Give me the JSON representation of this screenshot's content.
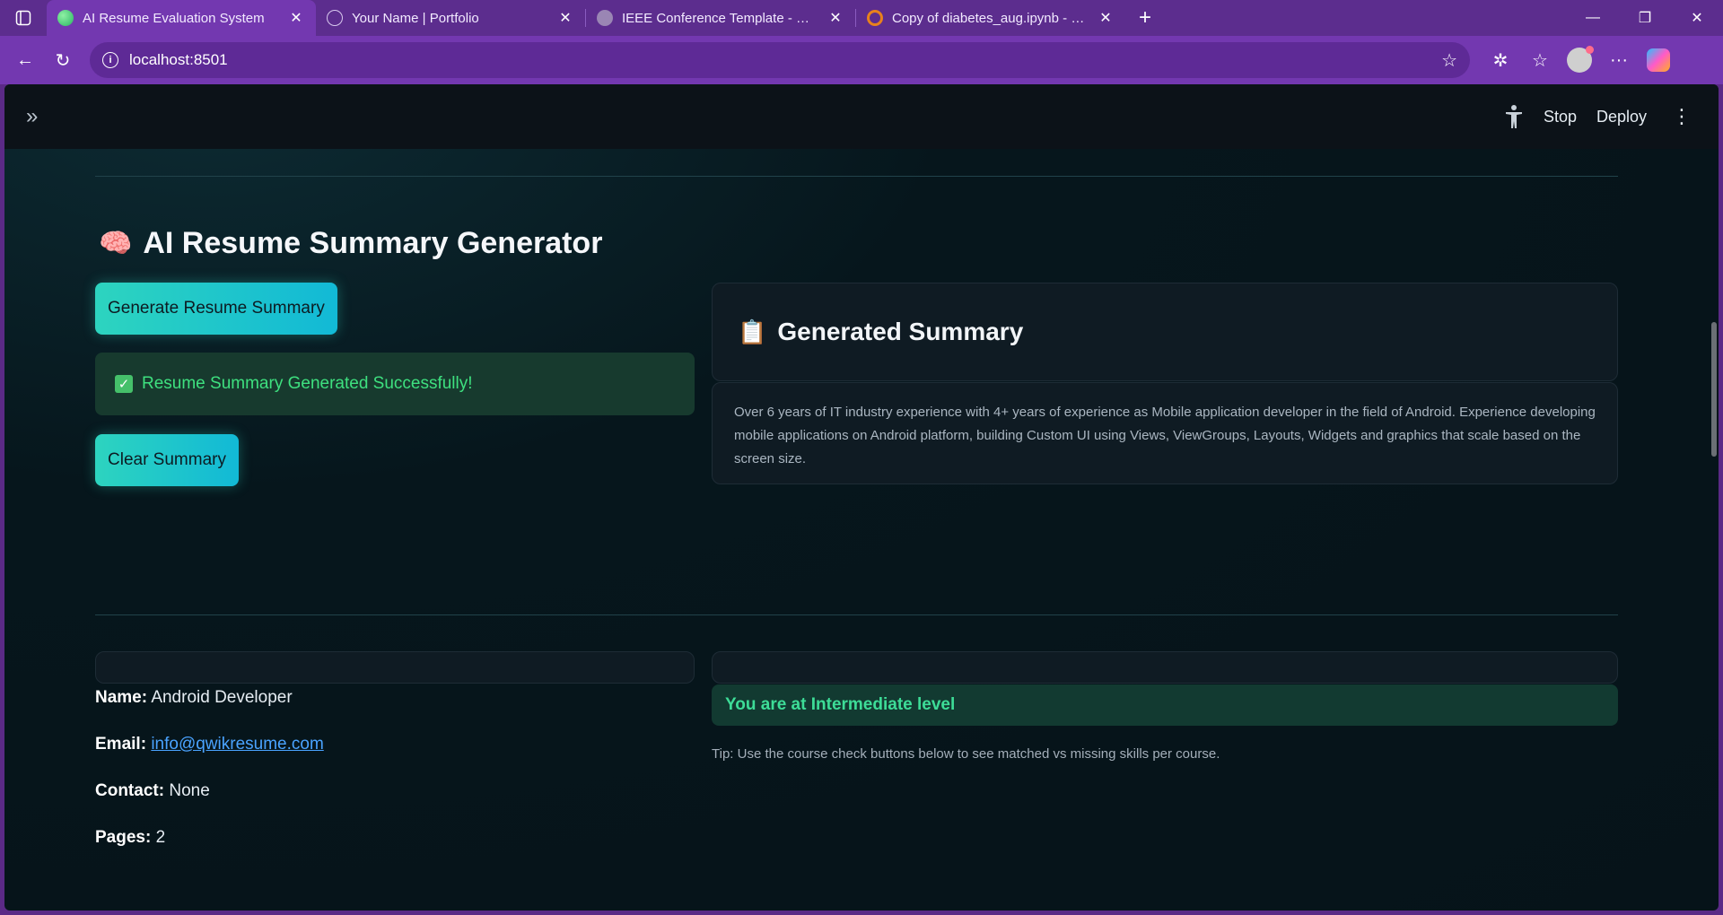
{
  "browser": {
    "tabs": [
      {
        "title": "AI Resume Evaluation System",
        "active": true,
        "favicon": "green-circle-icon"
      },
      {
        "title": "Your Name | Portfolio",
        "active": false,
        "favicon": "globe-icon"
      },
      {
        "title": "IEEE Conference Template - Online",
        "active": false,
        "favicon": "overleaf-icon"
      },
      {
        "title": "Copy of diabetes_aug.ipynb - Colab",
        "active": false,
        "favicon": "colab-icon"
      }
    ],
    "url": "localhost:8501"
  },
  "app_header": {
    "stop_label": "Stop",
    "deploy_label": "Deploy"
  },
  "main": {
    "title": "AI Resume Summary Generator",
    "title_icon": "🧠",
    "generate_button": "Generate Resume Summary",
    "success_message": "Resume Summary Generated Successfully!",
    "clear_button": "Clear Summary",
    "summary_title": "Generated Summary",
    "summary_icon": "📋",
    "summary_text": "Over 6 years of IT industry experience with 4+ years of experience as Mobile application developer in the field of Android. Experience developing mobile applications on Android platform, building Custom UI using Views, ViewGroups, Layouts, Widgets and graphics that scale based on the screen size."
  },
  "details": {
    "name_label": "Name:",
    "name_value": "Android Developer",
    "email_label": "Email:",
    "email_value": "info@qwikresume.com",
    "contact_label": "Contact:",
    "contact_value": "None",
    "pages_label": "Pages:",
    "pages_value": "2"
  },
  "level": {
    "message": "You are at Intermediate level",
    "tip": "Tip: Use the course check buttons below to see matched vs missing skills per course."
  },
  "colors": {
    "accent": "#2dd4bf",
    "success_text": "#3ee07f",
    "level_text": "#3ddc97",
    "browser_frame": "#7338b0"
  }
}
